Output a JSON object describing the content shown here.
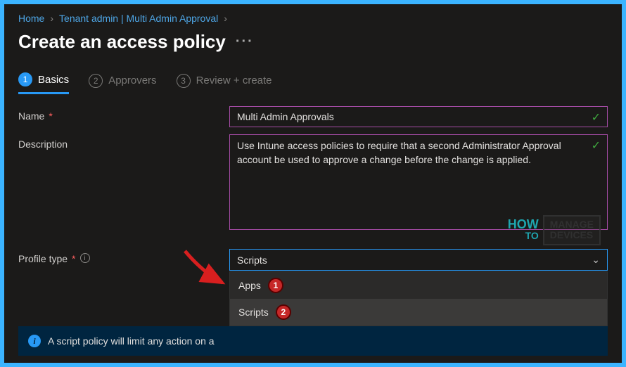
{
  "breadcrumb": {
    "home": "Home",
    "tenant": "Tenant admin | Multi Admin Approval"
  },
  "page": {
    "title": "Create an access policy"
  },
  "wizard": {
    "steps": [
      {
        "num": "1",
        "label": "Basics"
      },
      {
        "num": "2",
        "label": "Approvers"
      },
      {
        "num": "3",
        "label": "Review + create"
      }
    ]
  },
  "form": {
    "name_label": "Name",
    "name_value": "Multi Admin Approvals",
    "description_label": "Description",
    "description_value": "Use Intune access policies to require that a second Administrator Approval account be used to approve a change before the change is applied.",
    "profile_type_label": "Profile type",
    "profile_type_value": "Scripts",
    "profile_type_options": [
      {
        "label": "Apps",
        "badge": "1"
      },
      {
        "label": "Scripts",
        "badge": "2"
      }
    ]
  },
  "banner": {
    "text": "A script policy will limit any action on a"
  },
  "watermark": {
    "how": "HOW",
    "to": "TO",
    "line1": "MANAGE",
    "line2": "DEVICES"
  }
}
